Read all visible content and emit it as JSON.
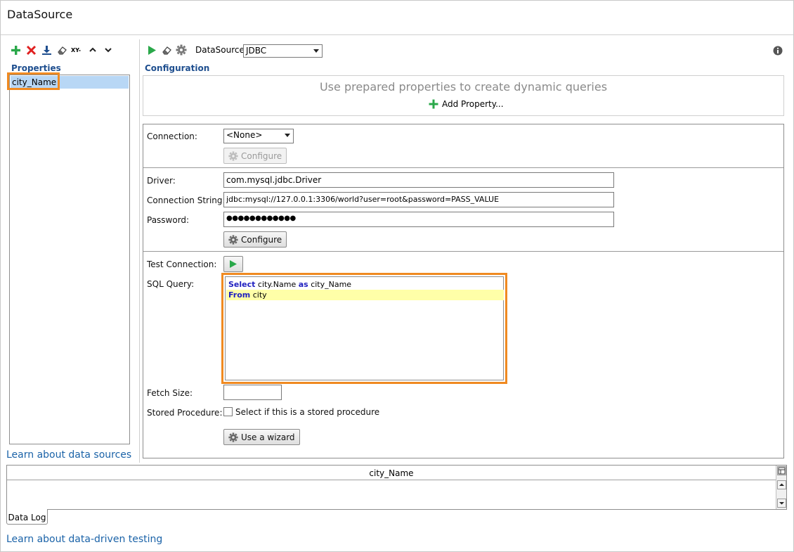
{
  "window": {
    "title": "DataSource"
  },
  "left_panel": {
    "toolbar": {
      "add": "add-icon",
      "delete": "delete-icon",
      "import": "download-icon",
      "clear": "eraser-icon",
      "xy_label": "XY-",
      "move_up": "chevron-up-icon",
      "move_down": "chevron-down-icon"
    },
    "heading": "Properties",
    "items": [
      "city_Name"
    ],
    "learn_link": "Learn about data sources"
  },
  "right_panel": {
    "toolbar": {
      "run": "play-icon",
      "clear": "eraser-icon",
      "settings": "gear-icon",
      "datasource_label": "DataSource:",
      "datasource_value": "JDBC",
      "info": "info-icon"
    },
    "configuration_heading": "Configuration",
    "hint_text": "Use prepared properties to create dynamic queries",
    "add_property": "Add Property...",
    "connection": {
      "label": "Connection:",
      "value": "<None>",
      "configure_button": "Configure"
    },
    "driver": {
      "label": "Driver:",
      "value": "com.mysql.jdbc.Driver"
    },
    "connection_string": {
      "label": "Connection String:",
      "value": "jdbc:mysql://127.0.0.1:3306/world?user=root&password=PASS_VALUE"
    },
    "password": {
      "label": "Password:",
      "value": "●●●●●●●●●●●●"
    },
    "password_configure_button": "Configure",
    "test_connection": {
      "label": "Test Connection:"
    },
    "sql_query": {
      "label": "SQL Query:",
      "line1": {
        "kw1": "Select",
        "text1": " city.Name ",
        "kw2": "as",
        "text2": " city_Name"
      },
      "line2": {
        "kw1": "From",
        "text1": " city"
      }
    },
    "fetch_size": {
      "label": "Fetch Size:",
      "value": ""
    },
    "stored_procedure": {
      "label": "Stored Procedure:",
      "checkbox_label": "Select if this is a stored procedure",
      "checked": false
    },
    "wizard_button": "Use a wizard"
  },
  "data_log": {
    "columns": [
      "city_Name"
    ],
    "tab": "Data Log"
  },
  "bottom_link": "Learn about data-driven testing",
  "colors": {
    "accent_green": "#2aa84a",
    "delete_red": "#e02020",
    "highlight_orange": "#f08a21",
    "heading_blue": "#1f4f8f",
    "link_blue": "#1b63a8",
    "selection_blue": "#b8d7f5",
    "sql_keyword": "#1f1fbf",
    "sql_line_highlight": "#ffffa8"
  }
}
